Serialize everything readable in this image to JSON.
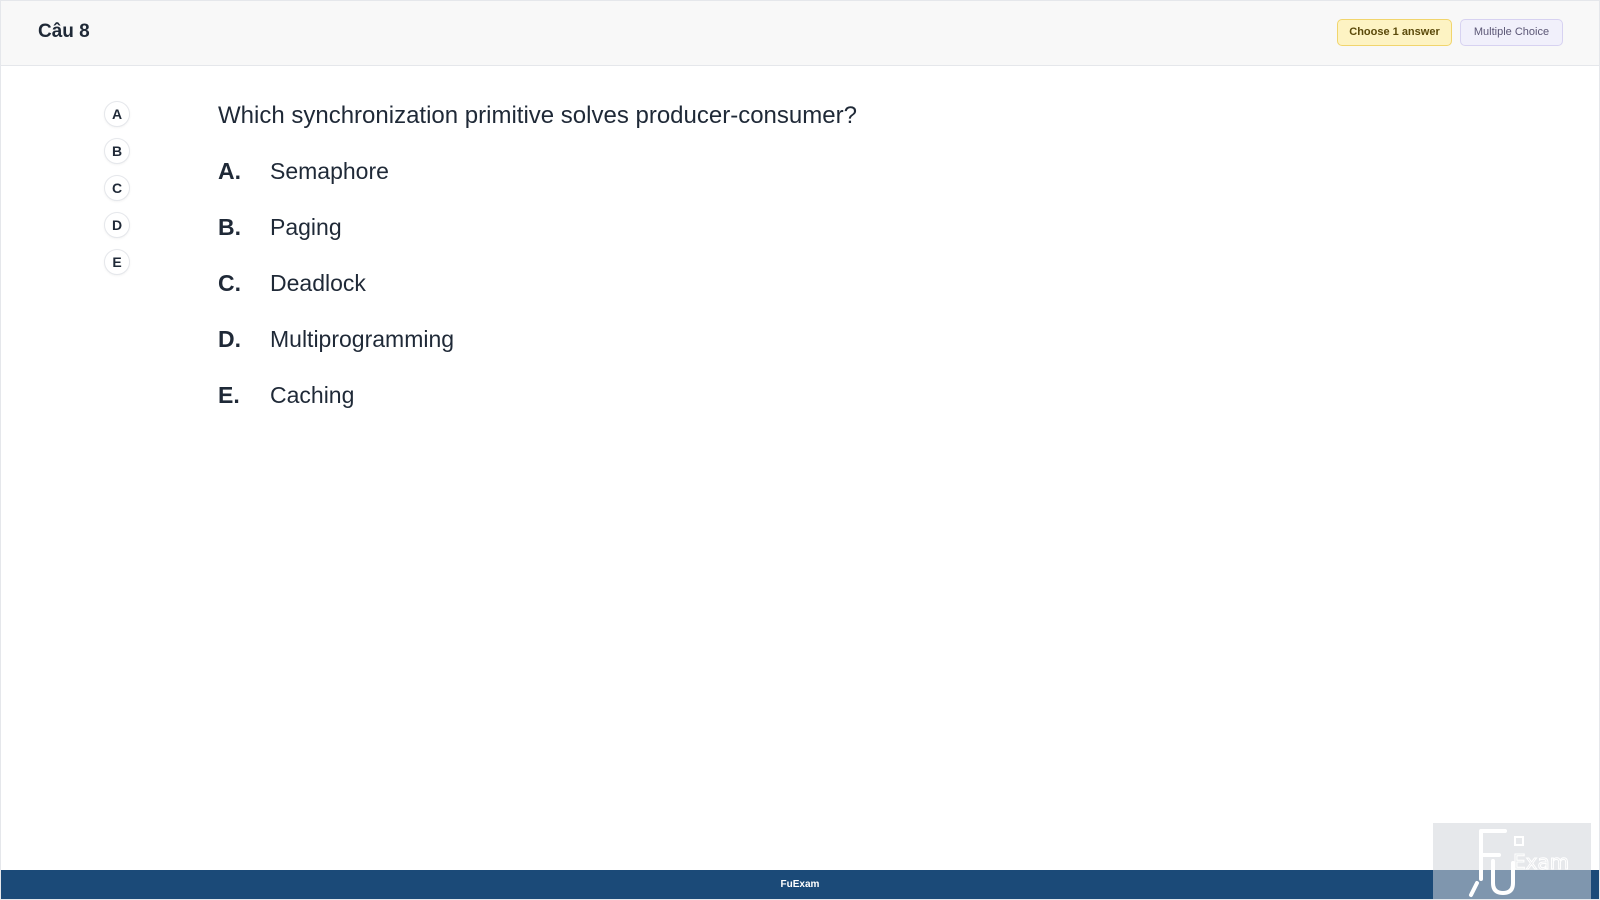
{
  "header": {
    "question_number": "Câu 8",
    "badge_choose": "Choose 1 answer",
    "badge_type": "Multiple Choice"
  },
  "nav": {
    "items": [
      "A",
      "B",
      "C",
      "D",
      "E"
    ]
  },
  "question": {
    "text": "Which synchronization primitive solves producer-consumer?",
    "options": [
      {
        "letter": "A.",
        "text": "Semaphore"
      },
      {
        "letter": "B.",
        "text": "Paging"
      },
      {
        "letter": "C.",
        "text": "Deadlock"
      },
      {
        "letter": "D.",
        "text": "Multiprogramming"
      },
      {
        "letter": "E.",
        "text": "Caching"
      }
    ]
  },
  "footer": {
    "brand": "FuExam"
  },
  "watermark": {
    "logo_text": "FUExam"
  },
  "colors": {
    "footer_bg": "#1b4a78",
    "badge_choose_bg": "#fdf3c3",
    "badge_type_bg": "#f1f0fb"
  }
}
